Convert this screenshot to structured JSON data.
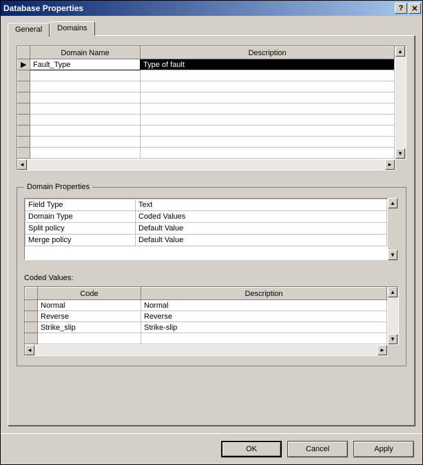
{
  "window": {
    "title": "Database Properties"
  },
  "tabs": {
    "general": "General",
    "domains": "Domains"
  },
  "domains_grid": {
    "col_name": "Domain Name",
    "col_desc": "Description",
    "rows": [
      {
        "name": "Fault_Type",
        "desc": "Type of fault"
      }
    ]
  },
  "properties": {
    "legend": "Domain Properties",
    "rows": [
      {
        "label": "Field Type",
        "value": "Text"
      },
      {
        "label": "Domain Type",
        "value": "Coded Values"
      },
      {
        "label": "Split policy",
        "value": "Default Value"
      },
      {
        "label": "Merge policy",
        "value": "Default Value"
      }
    ]
  },
  "coded": {
    "label": "Coded Values:",
    "col_code": "Code",
    "col_desc": "Description",
    "rows": [
      {
        "code": "Normal",
        "desc": "Normal"
      },
      {
        "code": "Reverse",
        "desc": "Reverse"
      },
      {
        "code": "Strike_slip",
        "desc": "Strike-slip"
      }
    ]
  },
  "buttons": {
    "ok": "OK",
    "cancel": "Cancel",
    "apply": "Apply"
  }
}
